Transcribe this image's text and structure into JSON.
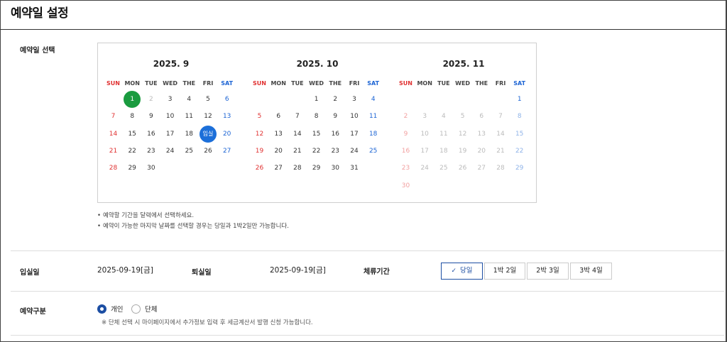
{
  "page": {
    "title": "예약일 설정"
  },
  "calendar": {
    "label": "예약일 선택",
    "dow": [
      "SUN",
      "MON",
      "TUE",
      "WED",
      "THE",
      "FRI",
      "SAT"
    ],
    "months": [
      {
        "title": "2025. 9",
        "weeks": [
          [
            "",
            "1",
            "2",
            "3",
            "4",
            "5",
            "6"
          ],
          [
            "7",
            "8",
            "9",
            "10",
            "11",
            "12",
            "13"
          ],
          [
            "14",
            "15",
            "16",
            "17",
            "18",
            "입실",
            "20"
          ],
          [
            "21",
            "22",
            "23",
            "24",
            "25",
            "26",
            "27"
          ],
          [
            "28",
            "29",
            "30",
            "",
            "",
            "",
            ""
          ]
        ],
        "states": [
          [
            "",
            "today",
            "disabled",
            "",
            "",
            "",
            ""
          ],
          [
            "",
            "",
            "",
            "",
            "",
            "",
            ""
          ],
          [
            "",
            "",
            "",
            "",
            "",
            "checkin",
            ""
          ],
          [
            "",
            "",
            "",
            "",
            "",
            "",
            ""
          ],
          [
            "",
            "",
            "",
            "",
            "",
            "",
            ""
          ]
        ]
      },
      {
        "title": "2025. 10",
        "weeks": [
          [
            "",
            "",
            "",
            "1",
            "2",
            "3",
            "4"
          ],
          [
            "5",
            "6",
            "7",
            "8",
            "9",
            "10",
            "11"
          ],
          [
            "12",
            "13",
            "14",
            "15",
            "16",
            "17",
            "18"
          ],
          [
            "19",
            "20",
            "21",
            "22",
            "23",
            "24",
            "25"
          ],
          [
            "26",
            "27",
            "28",
            "29",
            "30",
            "31",
            ""
          ]
        ],
        "states": [
          [
            "",
            "",
            "",
            "",
            "",
            "",
            ""
          ],
          [
            "",
            "",
            "",
            "",
            "",
            "",
            ""
          ],
          [
            "",
            "",
            "",
            "",
            "",
            "",
            ""
          ],
          [
            "",
            "",
            "",
            "",
            "",
            "",
            ""
          ],
          [
            "",
            "",
            "",
            "",
            "",
            "",
            ""
          ]
        ]
      },
      {
        "title": "2025. 11",
        "weeks": [
          [
            "",
            "",
            "",
            "",
            "",
            "",
            "1"
          ],
          [
            "2",
            "3",
            "4",
            "5",
            "6",
            "7",
            "8"
          ],
          [
            "9",
            "10",
            "11",
            "12",
            "13",
            "14",
            "15"
          ],
          [
            "16",
            "17",
            "18",
            "19",
            "20",
            "21",
            "22"
          ],
          [
            "23",
            "24",
            "25",
            "26",
            "27",
            "28",
            "29"
          ],
          [
            "30",
            "",
            "",
            "",
            "",
            "",
            ""
          ]
        ],
        "states": [
          [
            "",
            "",
            "",
            "",
            "",
            "",
            ""
          ],
          [
            "disabled",
            "disabled",
            "disabled",
            "disabled",
            "disabled",
            "disabled",
            "disabled"
          ],
          [
            "disabled",
            "disabled",
            "disabled",
            "disabled",
            "disabled",
            "disabled",
            "disabled"
          ],
          [
            "disabled",
            "disabled",
            "disabled",
            "disabled",
            "disabled",
            "disabled",
            "disabled"
          ],
          [
            "disabled",
            "disabled",
            "disabled",
            "disabled",
            "disabled",
            "disabled",
            "disabled"
          ],
          [
            "disabled",
            "",
            "",
            "",
            "",
            "",
            ""
          ]
        ]
      }
    ],
    "notes": [
      "예약할 기간을 달력에서 선택하세요.",
      "예약이 가능한 마지막 날짜를 선택할 경우는 당일과 1박2일만 가능합니다."
    ]
  },
  "stay": {
    "checkin_label": "입실일",
    "checkin_value": "2025-09-19[금]",
    "checkout_label": "퇴실일",
    "checkout_value": "2025-09-19[금]",
    "period_label": "체류기간",
    "options": [
      "당일",
      "1박 2일",
      "2박 3일",
      "3박 4일"
    ],
    "selected": 0
  },
  "booking_type": {
    "label": "예약구분",
    "options": [
      "개인",
      "단체"
    ],
    "selected": 0,
    "note": "※ 단체 선택 시 마이페이지에서 추가정보 입력 후 세금계산서 발행 신청 가능합니다."
  },
  "colors": {
    "accent": "#1c4ea3",
    "sunday": "#e03131",
    "saturday": "#1c64d4",
    "today": "#1a9b3f",
    "checkin": "#1c6fd9"
  },
  "icons": {
    "check": "check-icon"
  }
}
